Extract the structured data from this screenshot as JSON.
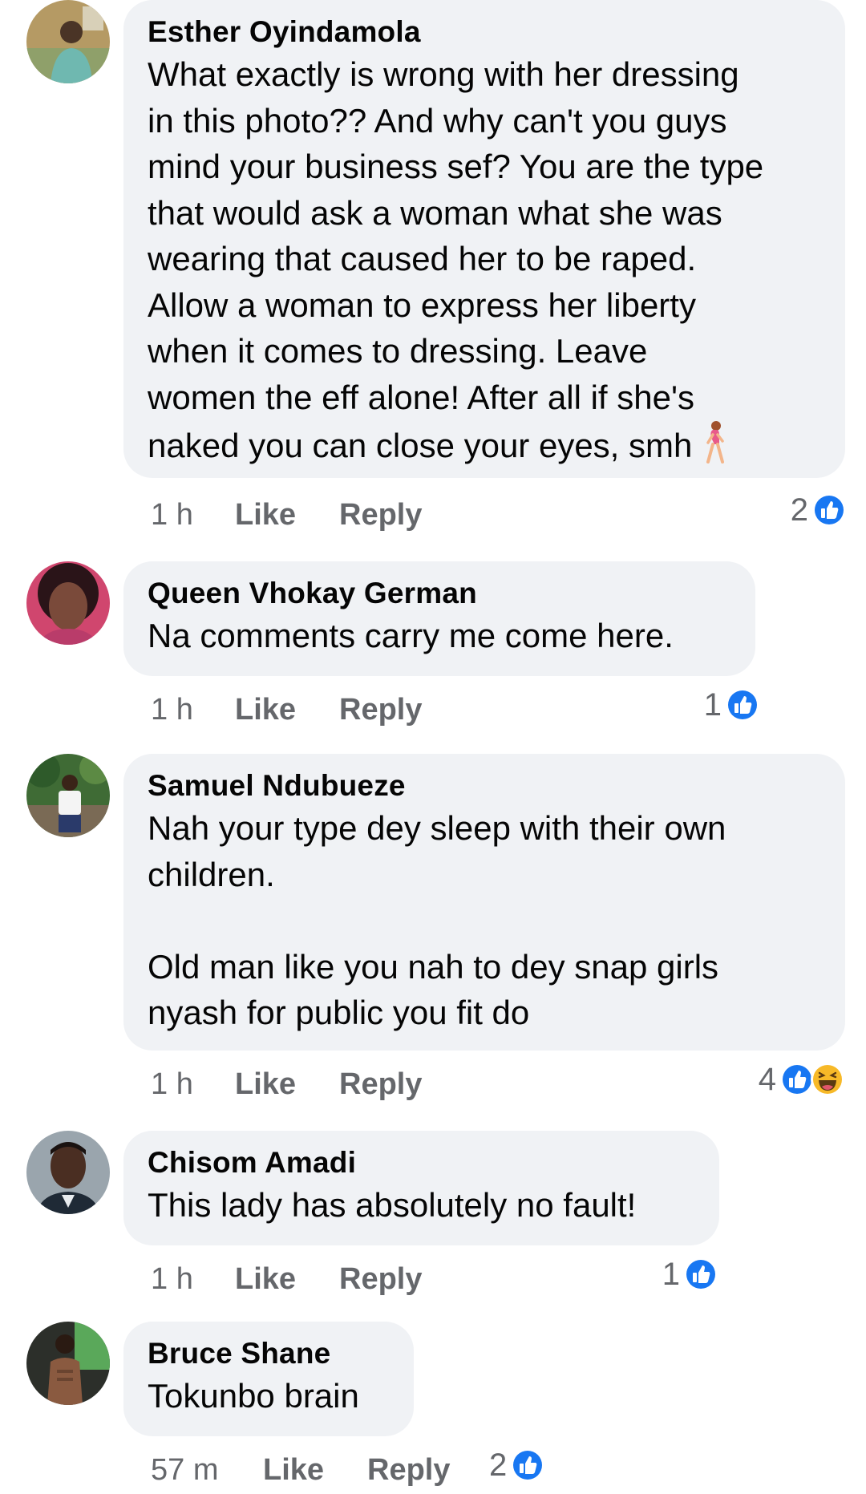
{
  "comments": [
    {
      "name": "Esther Oyindamola",
      "text": "What exactly is wrong with her dressing\nin this photo?? And why can't you guys\nmind your business sef? You are the type\nthat would ask a woman what she was\nwearing that caused her to be raped.\nAllow a woman to express her liberty\nwhen it comes to dressing. Leave\nwomen the eff alone! After all if she's\nnaked you can close your eyes, smh",
      "time": "1 h",
      "like": "Like",
      "reply": "Reply",
      "reaction_count": "2",
      "reactions": [
        "like-icon"
      ]
    },
    {
      "name": "Queen Vhokay German",
      "text": "Na comments carry me come here.",
      "time": "1 h",
      "like": "Like",
      "reply": "Reply",
      "reaction_count": "1",
      "reactions": [
        "like-icon"
      ]
    },
    {
      "name": "Samuel Ndubueze",
      "text": "Nah your type dey sleep with their own\nchildren.\n\nOld man like you nah to dey snap girls\nnyash for public you fit do",
      "time": "1 h",
      "like": "Like",
      "reply": "Reply",
      "reaction_count": "4",
      "reactions": [
        "like-icon",
        "laugh-icon"
      ]
    },
    {
      "name": "Chisom Amadi",
      "text": "This lady has absolutely no fault!",
      "time": "1 h",
      "like": "Like",
      "reply": "Reply",
      "reaction_count": "1",
      "reactions": [
        "like-icon"
      ]
    },
    {
      "name": "Bruce Shane",
      "text": "Tokunbo brain",
      "time": "57 m",
      "like": "Like",
      "reply": "Reply",
      "reaction_count": "2",
      "reactions": [
        "like-icon"
      ]
    }
  ],
  "colors": {
    "bubble": "#f0f2f5",
    "meta_text": "#65676b",
    "like_blue": "#1877f2",
    "laugh_yellow": "#f7b928"
  }
}
